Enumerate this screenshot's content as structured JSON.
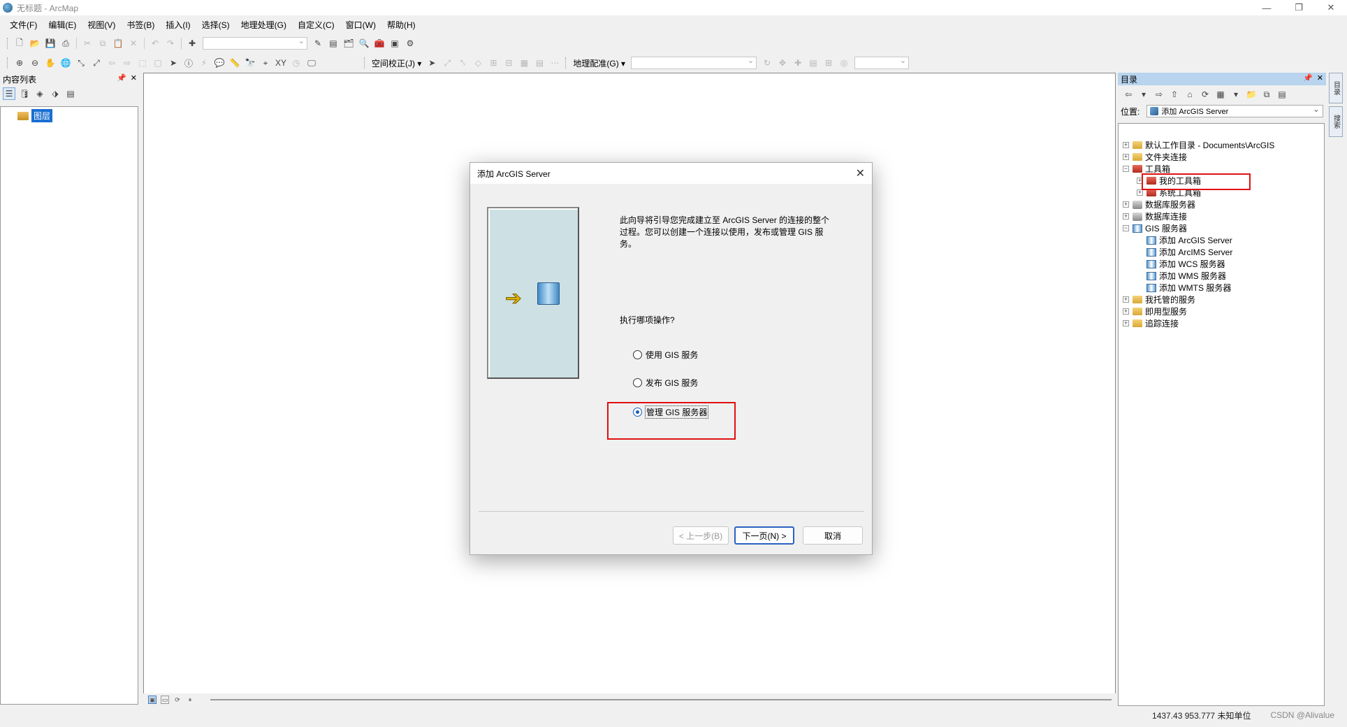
{
  "window": {
    "title": "无标题 - ArcMap"
  },
  "menu": [
    "文件(F)",
    "编辑(E)",
    "视图(V)",
    "书签(B)",
    "插入(I)",
    "选择(S)",
    "地理处理(G)",
    "自定义(C)",
    "窗口(W)",
    "帮助(H)"
  ],
  "toolbar": {
    "spatial_adjust_label": "空间校正(J) ▾",
    "georef_label": "地理配准(G) ▾"
  },
  "toc": {
    "title": "内容列表",
    "layer_label": "图层"
  },
  "catalog": {
    "title": "目录",
    "location_label": "位置:",
    "location_value": "添加 ArcGIS Server",
    "tree": [
      {
        "label": "默认工作目录 - Documents\\ArcGIS",
        "expander": "+",
        "icon": "folder-icon",
        "level": 0
      },
      {
        "label": "文件夹连接",
        "expander": "+",
        "icon": "folder-icon",
        "level": 0
      },
      {
        "label": "工具箱",
        "expander": "−",
        "icon": "toolbox-icon",
        "level": 0
      },
      {
        "label": "我的工具箱",
        "expander": "+",
        "icon": "toolbox-icon",
        "level": 1
      },
      {
        "label": "系统工具箱",
        "expander": "+",
        "icon": "toolbox-icon",
        "level": 1
      },
      {
        "label": "数据库服务器",
        "expander": "+",
        "icon": "db-icon",
        "level": 0
      },
      {
        "label": "数据库连接",
        "expander": "+",
        "icon": "db-icon",
        "level": 0
      },
      {
        "label": "GIS 服务器",
        "expander": "−",
        "icon": "server-icon",
        "level": 0
      },
      {
        "label": "添加 ArcGIS Server",
        "expander": "",
        "icon": "server-icon",
        "level": 1
      },
      {
        "label": "添加 ArcIMS Server",
        "expander": "",
        "icon": "server-icon",
        "level": 1
      },
      {
        "label": "添加 WCS 服务器",
        "expander": "",
        "icon": "server-icon",
        "level": 1
      },
      {
        "label": "添加 WMS 服务器",
        "expander": "",
        "icon": "server-icon",
        "level": 1
      },
      {
        "label": "添加 WMTS 服务器",
        "expander": "",
        "icon": "server-icon",
        "level": 1
      },
      {
        "label": "我托管的服务",
        "expander": "+",
        "icon": "folder-icon",
        "level": 0
      },
      {
        "label": "即用型服务",
        "expander": "+",
        "icon": "folder-icon",
        "level": 0
      },
      {
        "label": "追踪连接",
        "expander": "+",
        "icon": "folder-icon",
        "level": 0
      }
    ]
  },
  "dock": {
    "tab1": "目录",
    "tab2": "搜索"
  },
  "status": {
    "coords": "1437.43  953.777 未知单位",
    "credit": "CSDN @Alivalue"
  },
  "dialog": {
    "title": "添加 ArcGIS Server",
    "description": "此向导将引导您完成建立至 ArcGIS Server 的连接的整个过程。您可以创建一个连接以使用，发布或管理 GIS 服务。",
    "question": "执行哪项操作?",
    "options": [
      "使用 GIS 服务",
      "发布 GIS 服务",
      "管理 GIS 服务器"
    ],
    "selected_option": "管理 GIS 服务器",
    "back_button": "< 上一步(B)",
    "next_button": "下一页(N) >",
    "cancel_button": "取消"
  }
}
